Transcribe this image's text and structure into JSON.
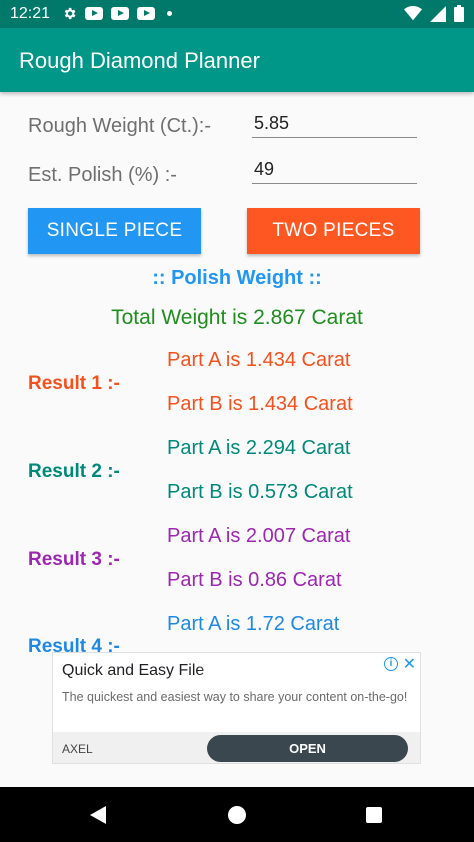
{
  "status_bar": {
    "time": "12:21",
    "icons_left": [
      "gear-icon",
      "youtube-icon",
      "youtube-icon",
      "youtube-icon",
      "dot-icon"
    ],
    "icons_right": [
      "wifi-icon",
      "signal-icon",
      "battery-icon"
    ]
  },
  "app_bar": {
    "title": "Rough Diamond Planner"
  },
  "form": {
    "rough_weight_label": "Rough Weight (Ct.):-",
    "rough_weight_value": "5.85",
    "polish_label": "Est. Polish (%) :-",
    "polish_value": "49"
  },
  "buttons": {
    "single_label": "SINGLE PIECE",
    "two_label": "TWO PIECES"
  },
  "colors": {
    "app_bar": "#009688",
    "single_button": "#2196f3",
    "two_button": "#ff5722",
    "total": "#1e8e1e"
  },
  "results": {
    "heading": ":: Polish Weight ::",
    "total": "Total Weight is 2.867 Carat",
    "r1": {
      "label": "Result 1 :-",
      "part_a": "Part A is 1.434 Carat",
      "part_b": "Part B is 1.434 Carat",
      "color": "#f4511e"
    },
    "r2": {
      "label": "Result 2 :-",
      "part_a": "Part A is 2.294 Carat",
      "part_b": "Part B is 0.573 Carat",
      "color": "#00897b"
    },
    "r3": {
      "label": "Result 3 :-",
      "part_a": "Part A is 2.007 Carat",
      "part_b": "Part B is 0.86 Carat",
      "color": "#9c27b0"
    },
    "r4": {
      "label": "Result 4 :-",
      "part_a": "Part A is 1.72 Carat",
      "color": "#1e88e5"
    }
  },
  "ad": {
    "title": "Quick and Easy File",
    "description": "The quickest and easiest way to share your content on-the-go!",
    "advertiser": "AXEL",
    "cta": "OPEN"
  }
}
